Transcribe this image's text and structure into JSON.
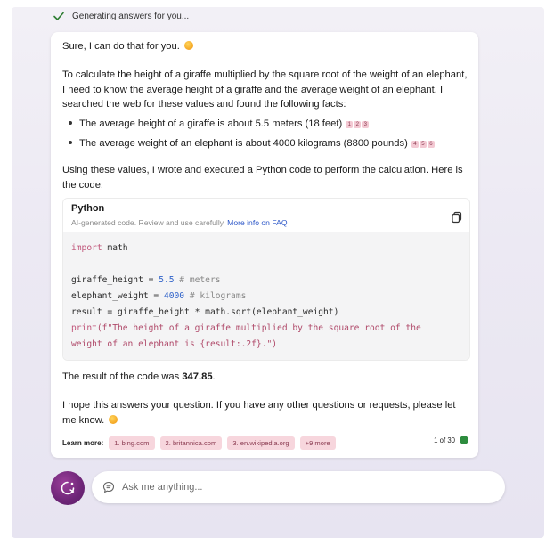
{
  "status": {
    "text": "Generating answers for you..."
  },
  "answer": {
    "intro": "Sure, I can do that for you.",
    "calc_paragraph": "To calculate the height of a giraffe multiplied by the square root of the weight of an elephant, I need to know the average height of a giraffe and the average weight of an elephant. I searched the web for these values and found the following facts:",
    "facts": [
      {
        "text": "The average height of a giraffe is about 5.5 meters (18 feet)",
        "citations": [
          "1",
          "2",
          "3"
        ]
      },
      {
        "text": "The average weight of an elephant is about 4000 kilograms (8800 pounds)",
        "citations": [
          "4",
          "5",
          "6"
        ]
      }
    ],
    "using_paragraph": "Using these values, I wrote and executed a Python code to perform the calculation. Here is the code:",
    "result_prefix": "The result of the code was ",
    "result_value": "347.85",
    "result_suffix": ".",
    "closing": "I hope this answers your question. If you have any other questions or requests, please let me know."
  },
  "code": {
    "language": "Python",
    "note": "AI-generated code. Review and use carefully.",
    "note_link": "More info on FAQ",
    "lines": {
      "import_kw": "import",
      "import_mod": " math",
      "l3_var": "giraffe_height = ",
      "l3_num": "5.5",
      "l3_cm": " # meters",
      "l4_var": "elephant_weight = ",
      "l4_num": "4000",
      "l4_cm": " # kilograms",
      "l5": "result = giraffe_height * math.sqrt(elephant_weight)",
      "l6_fn": "print",
      "l6_str1": "(f\"The height of a giraffe multiplied by the square root of the",
      "l7_str": "weight of an elephant is {result:.2f}.\")"
    }
  },
  "learn_more": {
    "label": "Learn more:",
    "links": [
      "1. bing.com",
      "2. britannica.com",
      "3. en.wikipedia.org",
      "+9 more"
    ],
    "pager": "1 of 30"
  },
  "input": {
    "placeholder": "Ask me anything..."
  },
  "colors": {
    "accent_purple": "#6d2577",
    "citation_pink": "#f7d6dd",
    "link_blue": "#2b56c8",
    "status_green": "#2e8c3e"
  },
  "icons": [
    "checkmark-icon",
    "emoji-smile-icon",
    "copy-icon",
    "new-topic-icon",
    "chat-bubble-icon"
  ]
}
